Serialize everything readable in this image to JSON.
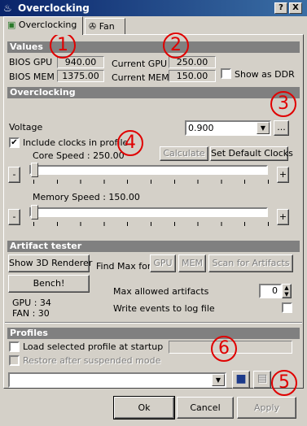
{
  "window": {
    "title": "Overclocking",
    "help_btn": "?",
    "close_btn": "X"
  },
  "tabs": [
    {
      "label": "Overclocking"
    },
    {
      "label": "Fan"
    }
  ],
  "values": {
    "header": "Values",
    "bios_gpu_label": "BIOS GPU",
    "bios_gpu": "940.00",
    "bios_mem_label": "BIOS MEM",
    "bios_mem": "1375.00",
    "current_gpu_label": "Current GPU",
    "current_gpu": "250.00",
    "current_mem_label": "Current MEM",
    "current_mem": "150.00",
    "show_ddr_label": "Show as DDR"
  },
  "overclocking": {
    "header": "Overclocking",
    "voltage_label": "Voltage",
    "voltage_value": "0.900",
    "more_btn": "...",
    "include_clocks_label": "Include clocks in profile",
    "include_clocks_checked": "✔",
    "core_speed_label": "Core Speed : 250.00",
    "calculate_btn": "Calculate",
    "set_default_btn": "Set Default Clocks",
    "memory_speed_label": "Memory Speed : 150.00",
    "minus": "-",
    "plus": "+"
  },
  "artifact": {
    "header": "Artifact tester",
    "show3d_btn": "Show 3D Renderer",
    "bench_btn": "Bench!",
    "find_max_label": "Find Max for",
    "gpu_btn": "GPU",
    "mem_btn": "MEM",
    "scan_btn": "Scan for Artifacts",
    "max_allowed_label": "Max allowed artifacts",
    "max_allowed_value": "0",
    "write_events_label": "Write events to log file",
    "gpu_temp": "GPU : 34",
    "fan": "FAN : 30"
  },
  "profiles": {
    "header": "Profiles",
    "load_startup_label": "Load selected profile at startup",
    "restore_label": "Restore after suspended mode"
  },
  "dialog": {
    "ok": "Ok",
    "cancel": "Cancel",
    "apply": "Apply"
  },
  "markers": [
    "1",
    "2",
    "3",
    "4",
    "5",
    "6"
  ],
  "colors": {
    "title_start": "#0a246a",
    "title_end": "#3a6ea5",
    "section": "#808080",
    "marker": "#e00000",
    "face": "#d4d0c8"
  }
}
